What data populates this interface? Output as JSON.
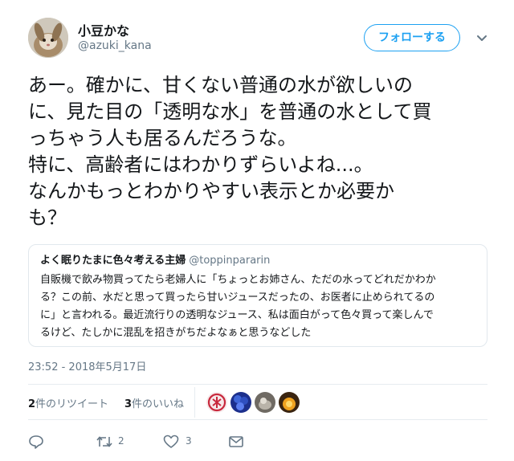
{
  "user": {
    "name": "小豆かな",
    "handle": "@azuki_kana",
    "follow_label": "フォローする"
  },
  "tweet": {
    "text": "あー。確かに、甘くない普通の水が欲しいの\nに、見た目の「透明な水」を普通の水として買\nっちゃう人も居るんだろうな。\n特に、高齢者にはわかりずらいよね...。\nなんかもっとわかりやすい表示とか必要か\nも？",
    "timestamp": "23:52 - 2018年5月17日"
  },
  "quote": {
    "name": "よく眠りたまに色々考える主婦",
    "handle": "@toppinpararin",
    "text": "自販機で飲み物買ってたら老婦人に「ちょっとお姉さん、ただの水ってどれだかわか\nる？この前、水だと思って買ったら甘いジュースだったの、お医者に止められてるの\nに」と言われる。最近流行りの透明なジュース、私は面白がって色々買って楽しんで\nるけど、たしかに混乱を招きがちだよなぁと思うなどした"
  },
  "stats": {
    "retweets_count": "2",
    "retweets_label": "件のリツイート",
    "likes_count": "3",
    "likes_label": "件のいいね"
  },
  "actions": {
    "retweet_count": "2",
    "like_count": "3"
  },
  "icons": [
    "reply-icon",
    "retweet-icon",
    "like-icon",
    "message-icon",
    "caret-down-icon"
  ],
  "colors": {
    "accent": "#1da1f2",
    "text": "#14171a",
    "secondary": "#657786",
    "border": "#e1e8ed"
  }
}
